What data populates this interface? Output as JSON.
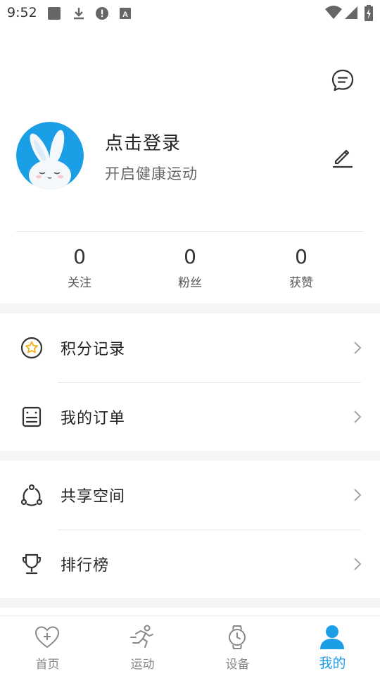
{
  "status_bar": {
    "time": "9:52"
  },
  "header": {
    "message_icon": "message-bubble-icon"
  },
  "profile": {
    "title": "点击登录",
    "subtitle": "开启健康运动",
    "edit_icon": "pencil-icon"
  },
  "stats": [
    {
      "value": "0",
      "label": "关注"
    },
    {
      "value": "0",
      "label": "粉丝"
    },
    {
      "value": "0",
      "label": "获赞"
    }
  ],
  "menu_groups": [
    [
      {
        "label": "积分记录",
        "icon": "star-circle-icon"
      },
      {
        "label": "我的订单",
        "icon": "order-list-icon"
      }
    ],
    [
      {
        "label": "共享空间",
        "icon": "share-network-icon"
      },
      {
        "label": "排行榜",
        "icon": "trophy-icon"
      }
    ]
  ],
  "bottom_nav": [
    {
      "label": "首页",
      "icon": "heart-plus-icon",
      "active": false
    },
    {
      "label": "运动",
      "icon": "runner-icon",
      "active": false
    },
    {
      "label": "设备",
      "icon": "watch-icon",
      "active": false
    },
    {
      "label": "我的",
      "icon": "person-icon",
      "active": true
    }
  ],
  "colors": {
    "accent": "#1a9ee6",
    "avatar_bg": "#1a9ee6",
    "star": "#f2b21c"
  }
}
